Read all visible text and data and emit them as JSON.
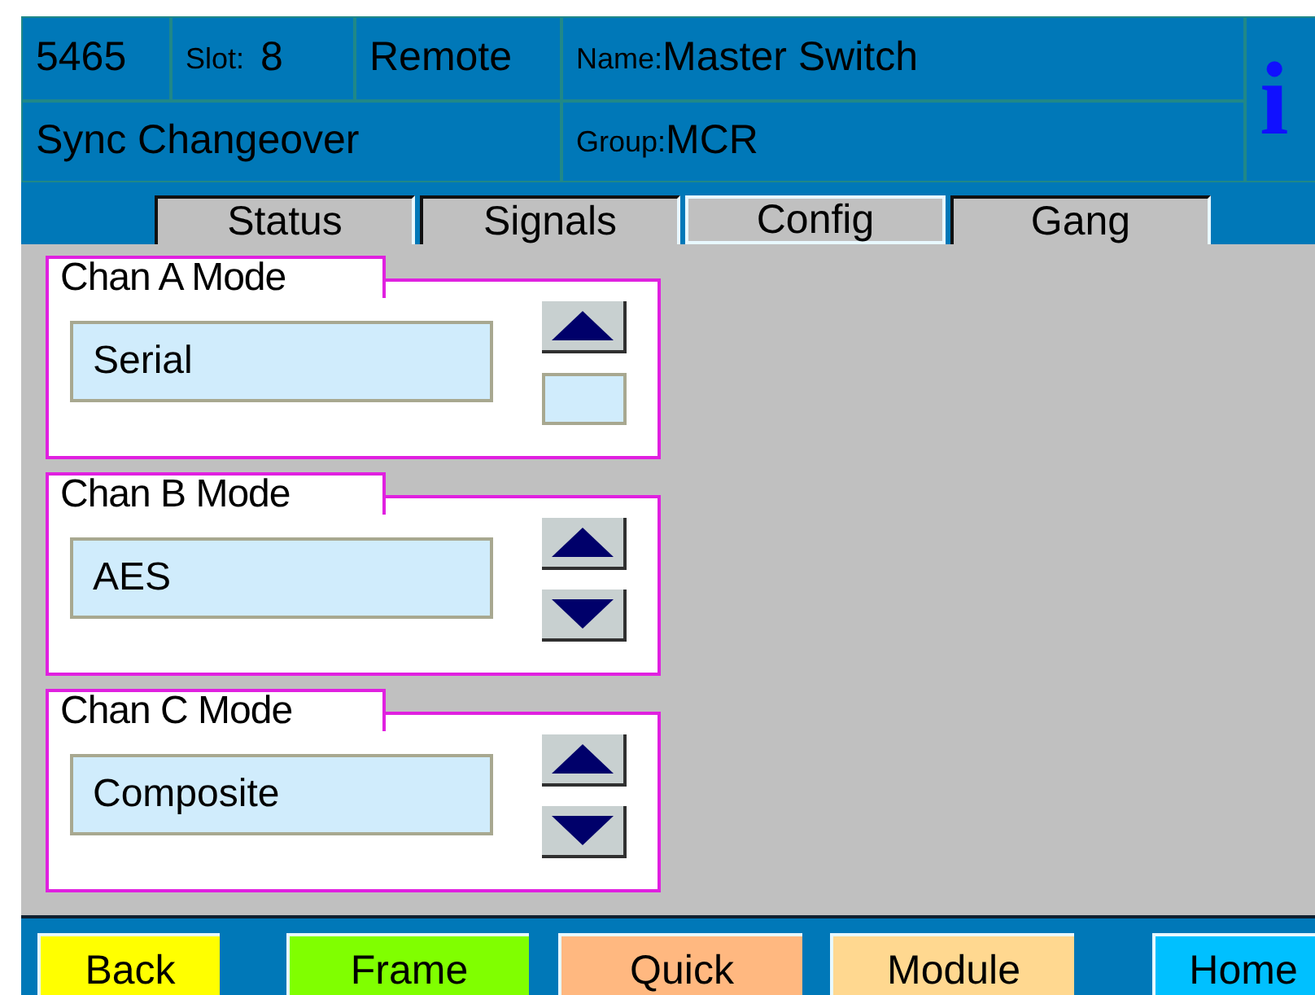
{
  "header": {
    "model": "5465",
    "slot": {
      "label": "Slot:",
      "value": "8"
    },
    "mode": "Remote",
    "name": {
      "label": "Name:",
      "value": "Master Switch"
    },
    "function": "Sync Changeover",
    "group": {
      "label": "Group:",
      "value": "MCR"
    },
    "info": "i"
  },
  "tabs": [
    {
      "label": "Status",
      "selected": false
    },
    {
      "label": "Signals",
      "selected": false
    },
    {
      "label": "Config",
      "selected": true
    },
    {
      "label": "Gang",
      "selected": false
    }
  ],
  "channels": [
    {
      "title": "Chan A Mode",
      "value": "Serial",
      "up_enabled": true,
      "down_enabled": false
    },
    {
      "title": "Chan B Mode",
      "value": "AES",
      "up_enabled": true,
      "down_enabled": true
    },
    {
      "title": "Chan C Mode",
      "value": "Composite",
      "up_enabled": true,
      "down_enabled": true
    }
  ],
  "nav_buttons": [
    {
      "label": "Back",
      "color": "#ffff00"
    },
    {
      "label": "Frame",
      "color": "#80ff00"
    },
    {
      "label": "Quick",
      "color": "#ffb880"
    },
    {
      "label": "Module",
      "color": "#ffd890"
    },
    {
      "label": "Home",
      "color": "#00c0ff"
    }
  ]
}
